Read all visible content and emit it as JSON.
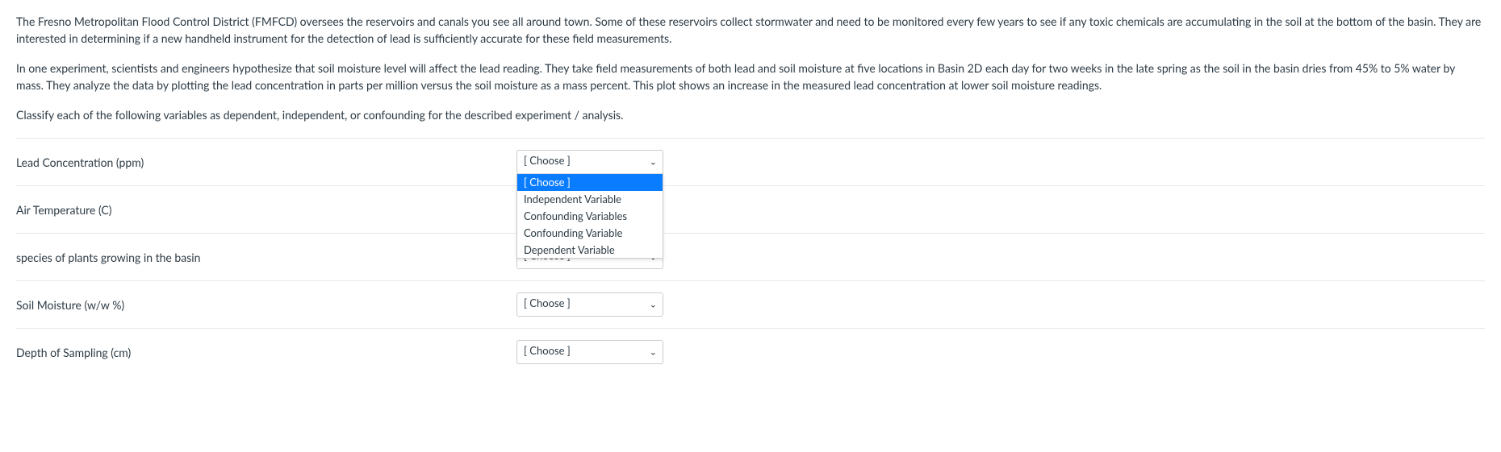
{
  "question": {
    "paragraph1": "The Fresno Metropolitan Flood Control District (FMFCD) oversees the reservoirs and canals you see all around town.  Some of these reservoirs collect stormwater and need to be monitored every few years to see if any toxic chemicals are accumulating in the soil at the bottom of the basin.  They are interested in determining if a new handheld instrument for the detection of lead is sufficiently accurate for these field measurements.",
    "paragraph2": "In one experiment, scientists and engineers hypothesize that soil moisture level will affect the lead reading.  They take field measurements of both lead and soil moisture at five locations in Basin 2D each day for two weeks in the late spring as the soil in the basin dries from 45% to 5% water by mass.  They analyze the data by plotting the lead concentration in parts per million versus the soil moisture as a mass percent.  This plot shows an increase in the measured lead concentration at lower soil moisture readings.",
    "paragraph3": "Classify each of the following variables as dependent, independent, or confounding for the described experiment / analysis."
  },
  "rows": [
    {
      "label": "Lead Concentration (ppm)",
      "selected": "[ Choose ]"
    },
    {
      "label": "Air Temperature (C)",
      "selected": ""
    },
    {
      "label": "species of plants growing in the basin",
      "selected": "[ Choose ]"
    },
    {
      "label": "Soil Moisture (w/w %)",
      "selected": "[ Choose ]"
    },
    {
      "label": "Depth of Sampling (cm)",
      "selected": "[ Choose ]"
    }
  ],
  "dropdown": {
    "options": [
      "[ Choose ]",
      "Independent Variable",
      "Confounding Variables",
      "Confounding Variable",
      "Dependent Variable"
    ]
  }
}
